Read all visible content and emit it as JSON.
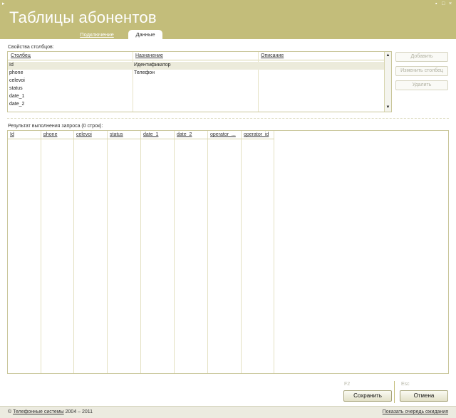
{
  "window": {
    "menu_glyph": "▸",
    "minimize_glyph": "▪",
    "maximize_glyph": "□",
    "close_glyph": "×"
  },
  "header": {
    "title": "Таблицы абонентов",
    "tabs": [
      {
        "label": "Подключение",
        "active": false
      },
      {
        "label": "Данные",
        "active": true
      }
    ]
  },
  "columns_panel": {
    "label": "Свойства столбцов:",
    "headers": [
      "Столбец",
      "Назначение",
      "Описание"
    ],
    "rows": [
      {
        "column": "Id",
        "purpose": "Идентификатор",
        "description": "",
        "selected": true
      },
      {
        "column": "phone",
        "purpose": "Телефон",
        "description": "",
        "selected": false
      },
      {
        "column": "celevoi",
        "purpose": "",
        "description": "",
        "selected": false
      },
      {
        "column": "status",
        "purpose": "",
        "description": "",
        "selected": false
      },
      {
        "column": "date_1",
        "purpose": "",
        "description": "",
        "selected": false
      },
      {
        "column": "date_2",
        "purpose": "",
        "description": "",
        "selected": false
      }
    ],
    "scroll_up_glyph": "▲",
    "scroll_down_glyph": "▼",
    "buttons": {
      "add": "Добавить",
      "edit": "Изменить столбец",
      "delete": "Удалить"
    }
  },
  "results_panel": {
    "label": "Результат выполнения запроса (0 строк):",
    "headers": [
      "Id",
      "phone",
      "celevoi",
      "status",
      "date_1",
      "date_2",
      "operator_...",
      "operator_id"
    ]
  },
  "actions": {
    "save_key": "F2",
    "save_label": "Сохранить",
    "cancel_key": "Esc",
    "cancel_label": "Отмена"
  },
  "footer": {
    "copyright_symbol": "©",
    "company_link": "Телефонные системы",
    "years": "2004 – 2011",
    "queue_link": "Показать очередь ожидания"
  },
  "colors": {
    "header_bg": "#c3bd7a",
    "grid_border": "#c9c69a",
    "footer_bg": "#ecebe0"
  }
}
